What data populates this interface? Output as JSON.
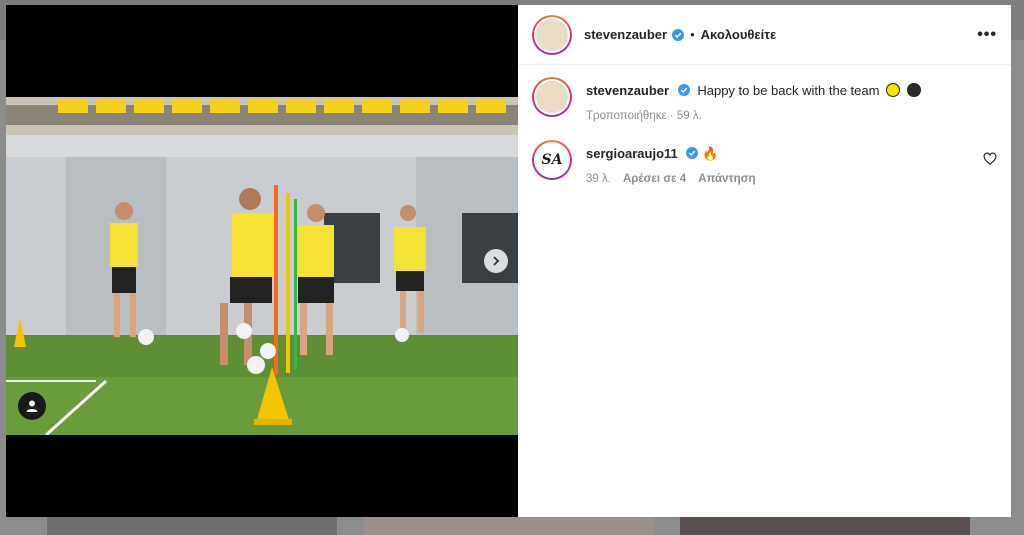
{
  "post": {
    "author": "stevenzauber",
    "follow_label": "Ακολουθείτε",
    "more_label": "•••",
    "separator": "•"
  },
  "caption": {
    "username": "stevenzauber",
    "text": "Happy to be back with the team",
    "emoji_colors": [
      "#f5e400",
      "#2b2b2b"
    ],
    "edited_label": "Τροποποιήθηκε",
    "time": "59 λ."
  },
  "comments": [
    {
      "username": "sergioaraujo11",
      "avatar_text": "SA",
      "emoji": "🔥",
      "time": "39 λ.",
      "likes_label": "Αρέσει σε 4",
      "reply_label": "Απάντηση"
    }
  ],
  "colors": {
    "verified": "#3897f0",
    "text": "#262626",
    "muted": "#8e8e8e"
  },
  "icons": [
    "verified-badge-icon",
    "more-options-icon",
    "next-arrow-icon",
    "user-tag-icon",
    "heart-icon"
  ]
}
